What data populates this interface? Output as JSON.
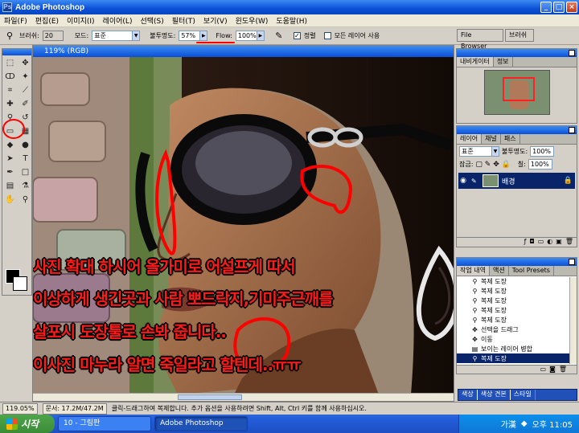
{
  "window": {
    "title": "Adobe Photoshop"
  },
  "menu": [
    "파일(F)",
    "편집(E)",
    "이미지(I)",
    "레이어(L)",
    "선택(S)",
    "필터(T)",
    "보기(V)",
    "윈도우(W)",
    "도움말(H)"
  ],
  "options": {
    "brush_label": "브러쉬:",
    "brush_size": "20",
    "mode_label": "모드:",
    "mode_value": "표준",
    "opacity_label": "불투명도:",
    "opacity_value": "57%",
    "flow_label": "Flow:",
    "flow_value": "100%",
    "aligned_label": "정렬",
    "all_layers_label": "모든 레이어 사용",
    "file_browser_tab": "File Browser",
    "brushes_tab": "브러쉬"
  },
  "document": {
    "title": "119% (RGB)"
  },
  "annotation": {
    "line1": "사진 확대 하시어 올가미로 어설프게 따서",
    "line2": "이상하게 생긴곳과 사람 뽀드락지,기미주근깨를",
    "line3": "살포시 도장툴로 손봐 줍니다..",
    "line4": "이사진 마누라 알면 죽일라고 할텐데..ㅠㅠ"
  },
  "navigator": {
    "tabs": [
      "내비게이터",
      "정보"
    ]
  },
  "layers": {
    "tabs": [
      "레이어",
      "채널",
      "패스"
    ],
    "mode": "표준",
    "opacity_label": "불투명도:",
    "opacity": "100%",
    "lock_label": "잠금:",
    "fill_label": "칠:",
    "fill": "100%",
    "layer_name": "배경"
  },
  "history": {
    "tabs": [
      "작업 내역",
      "액션",
      "Tool Presets"
    ],
    "items": [
      "복제 도장",
      "복제 도장",
      "복제 도장",
      "복제 도장",
      "복제 도장",
      "선택을 드래그",
      "이동",
      "보이는 레이어 병합",
      "복제 도장"
    ],
    "selected_index": 8
  },
  "palette_tabs_bottom": [
    "색상",
    "색상 견본",
    "스타일"
  ],
  "status": {
    "zoom": "119.05%",
    "doc": "문서: 17.2M/47.2M",
    "hint": "클릭-드래그하여 복제합니다. 추가 옵션을 사용하려면 Shift, Alt, Ctrl 키를 함께 사용하십시오."
  },
  "taskbar": {
    "start": "시작",
    "buttons": [
      "10 - 그림판",
      "Adobe Photoshop"
    ],
    "tray_lang": "가漢",
    "clock": "오후 11:05"
  },
  "colors": {
    "annotation": "#ff1a1a",
    "titlebar": "#0a50d8",
    "taskbar": "#245edb"
  }
}
